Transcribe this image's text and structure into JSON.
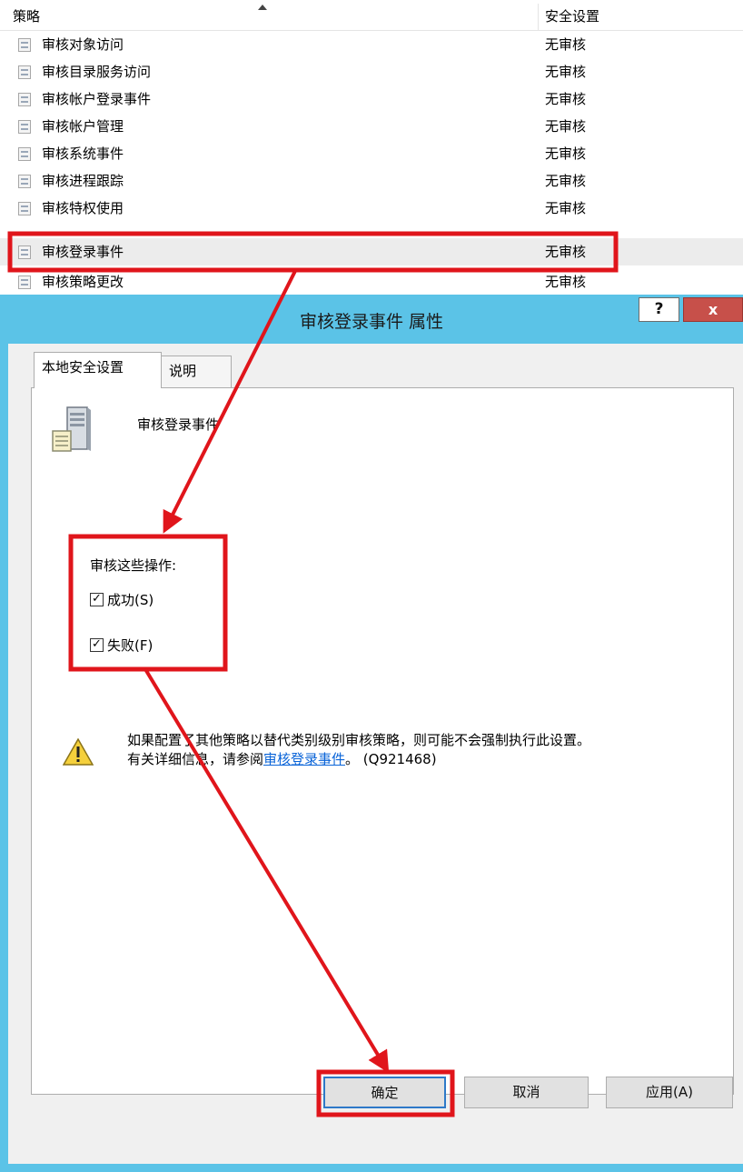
{
  "policy_list": {
    "header": {
      "policy_col": "策略",
      "setting_col": "安全设置"
    },
    "rows": [
      {
        "name": "审核对象访问",
        "value": "无审核"
      },
      {
        "name": "审核目录服务访问",
        "value": "无审核"
      },
      {
        "name": "审核帐户登录事件",
        "value": "无审核"
      },
      {
        "name": "审核帐户管理",
        "value": "无审核"
      },
      {
        "name": "审核系统事件",
        "value": "无审核"
      },
      {
        "name": "审核进程跟踪",
        "value": "无审核"
      },
      {
        "name": "审核特权使用",
        "value": "无审核"
      },
      {
        "name": "审核登录事件",
        "value": "无审核",
        "selected": true
      },
      {
        "name": "审核策略更改",
        "value": "无审核"
      }
    ]
  },
  "dialog": {
    "title": "审核登录事件 属性",
    "help_label": "?",
    "close_label": "x",
    "tabs": [
      {
        "label": "本地安全设置",
        "active": true
      },
      {
        "label": "说明",
        "active": false
      }
    ],
    "policy_name": "审核登录事件",
    "audit_label": "审核这些操作:",
    "checkboxes": [
      {
        "label": "成功(S)",
        "checked": true
      },
      {
        "label": "失败(F)",
        "checked": true
      }
    ],
    "warning": {
      "line1": "如果配置了其他策略以替代类别级别审核策略，则可能不会强制执行此设置。",
      "line2_prefix": "有关详细信息，请参阅",
      "link": "审核登录事件",
      "line2_suffix": "。 (Q921468)"
    },
    "buttons": {
      "ok": "确定",
      "cancel": "取消",
      "apply": "应用(A)"
    }
  },
  "colors": {
    "annotation": "#e0151b",
    "titlebar": "#5bc3e7",
    "link": "#0a64d8"
  },
  "icons": [
    "policy-item-icon",
    "server-document-icon",
    "warning-icon",
    "checkmark-icon",
    "sort-ascending-icon"
  ]
}
